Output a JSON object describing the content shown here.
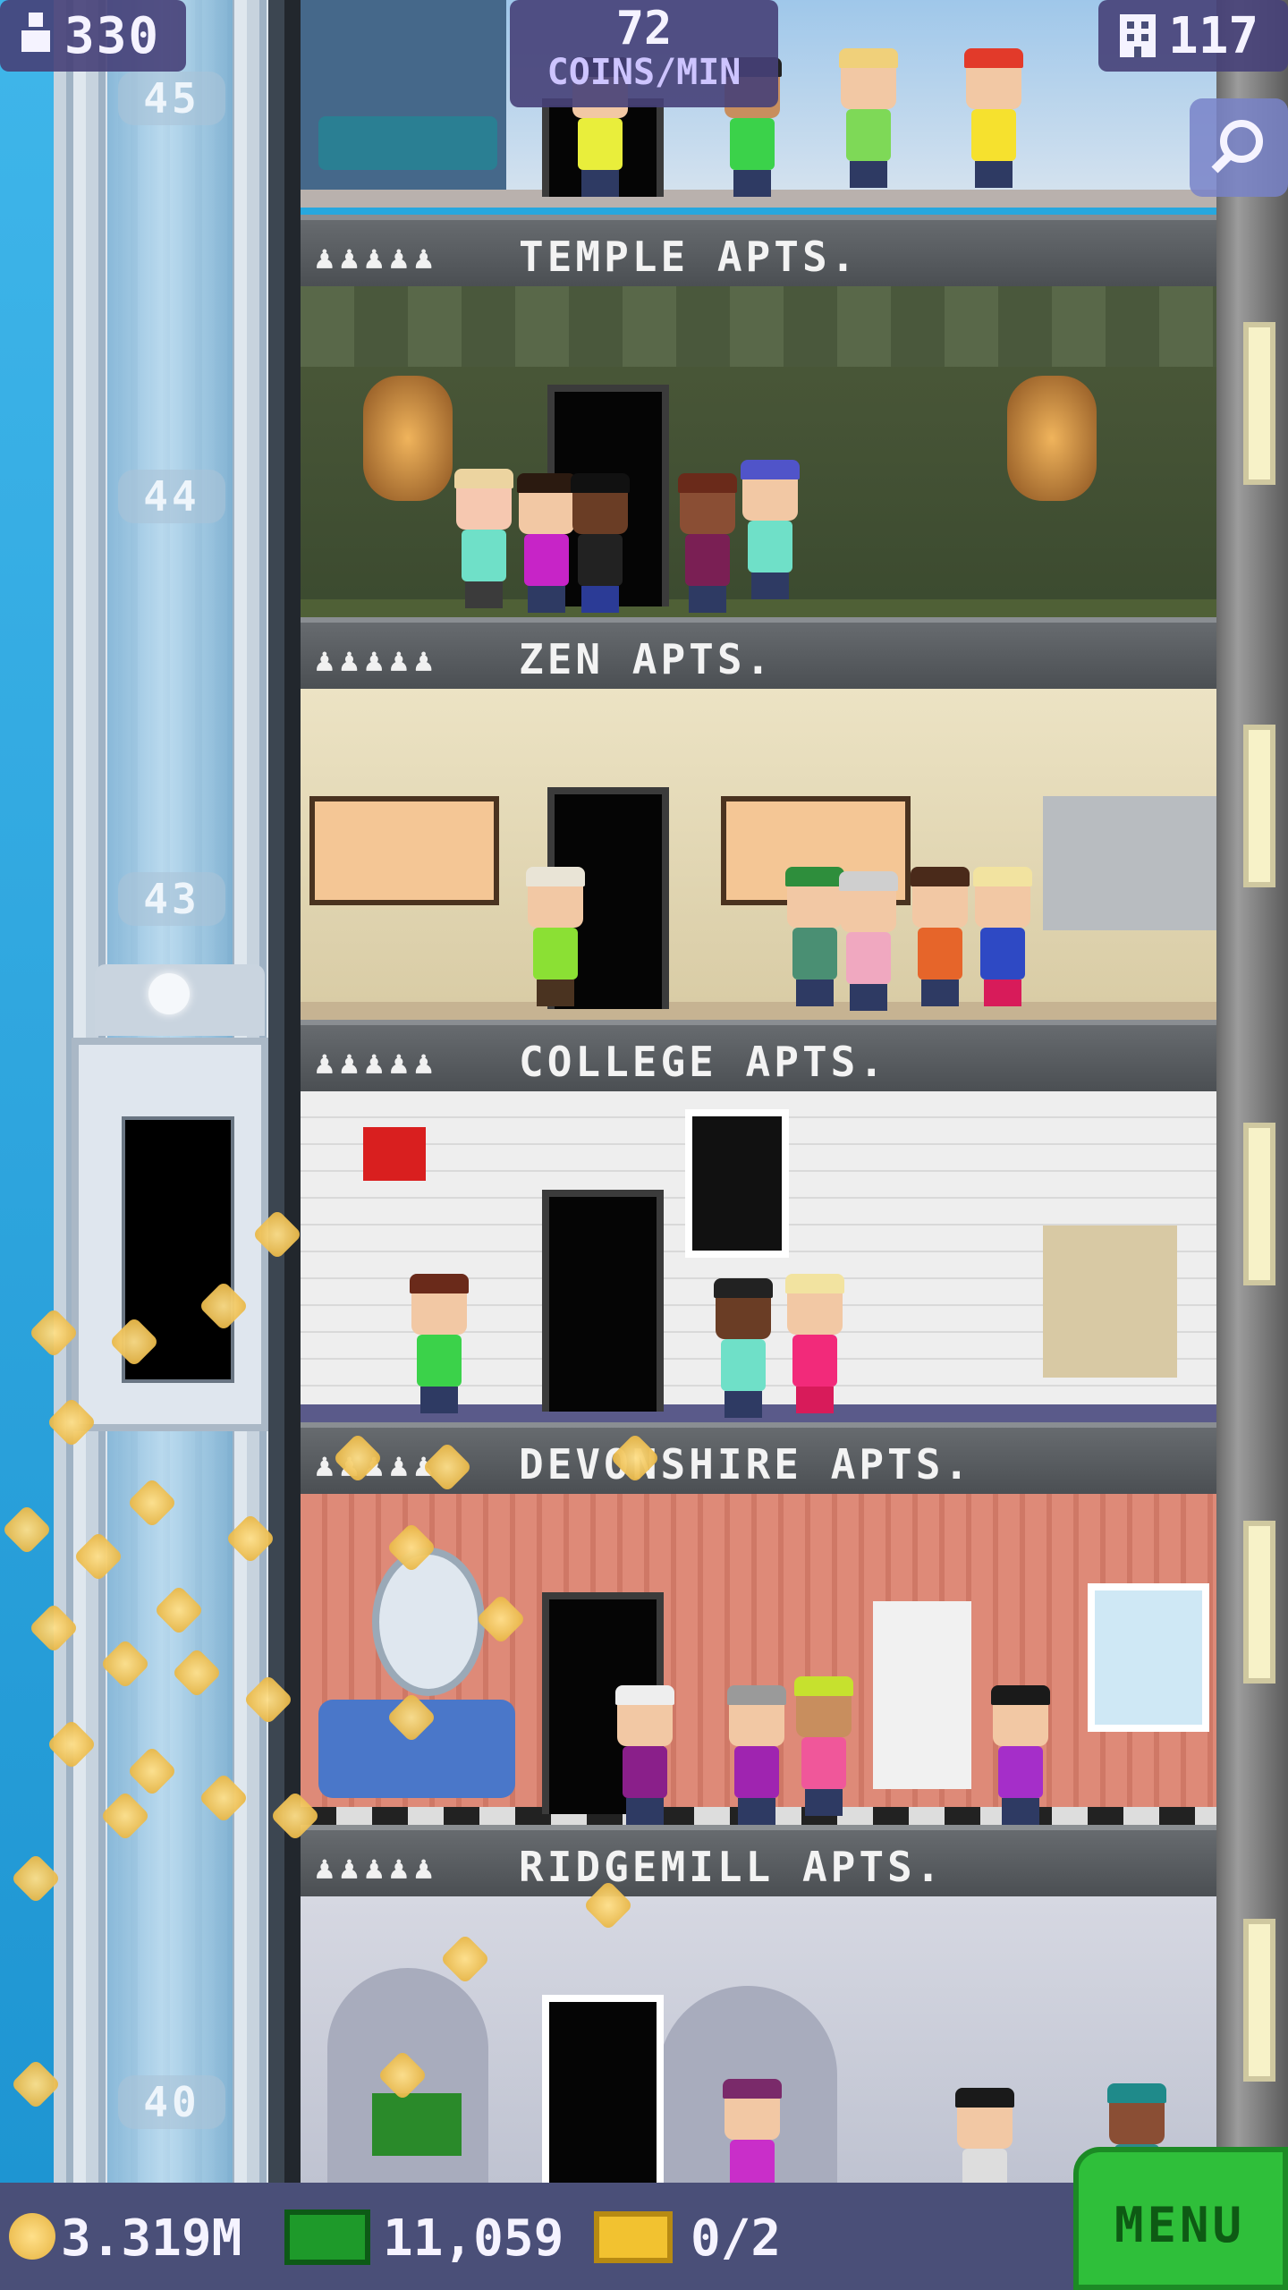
{
  "hud": {
    "population": "330",
    "coins_per_min_value": "72",
    "coins_per_min_label": "COINS/MIN",
    "floors": "117"
  },
  "shaft_floor_numbers": [
    "45",
    "44",
    "43",
    "40"
  ],
  "floors": [
    {
      "name": "TEMPLE APTS.",
      "residents_icons": "♟♟♟♟♟"
    },
    {
      "name": "ZEN APTS.",
      "residents_icons": "♟♟♟♟♟"
    },
    {
      "name": "COLLEGE APTS.",
      "residents_icons": "♟♟♟♟♟"
    },
    {
      "name": "DEVONSHIRE APTS.",
      "residents_icons": "♟♟♟♟♟"
    },
    {
      "name": "RIDGEMILL APTS.",
      "residents_icons": "♟♟♟♟♟"
    }
  ],
  "bottom": {
    "coins": "3.319M",
    "bux": "11,059",
    "tickets": "0/2",
    "menu_label": "MENU"
  },
  "colors": {
    "menu_green": "#2fbf3a",
    "hud_purple": "#4a4f78",
    "banner_gray": "#55595d"
  },
  "icons": {
    "population": "person-icon",
    "floors": "building-icon",
    "search": "magnifier-icon",
    "coin": "coin-icon",
    "bux": "cash-icon",
    "ticket": "ticket-icon"
  }
}
